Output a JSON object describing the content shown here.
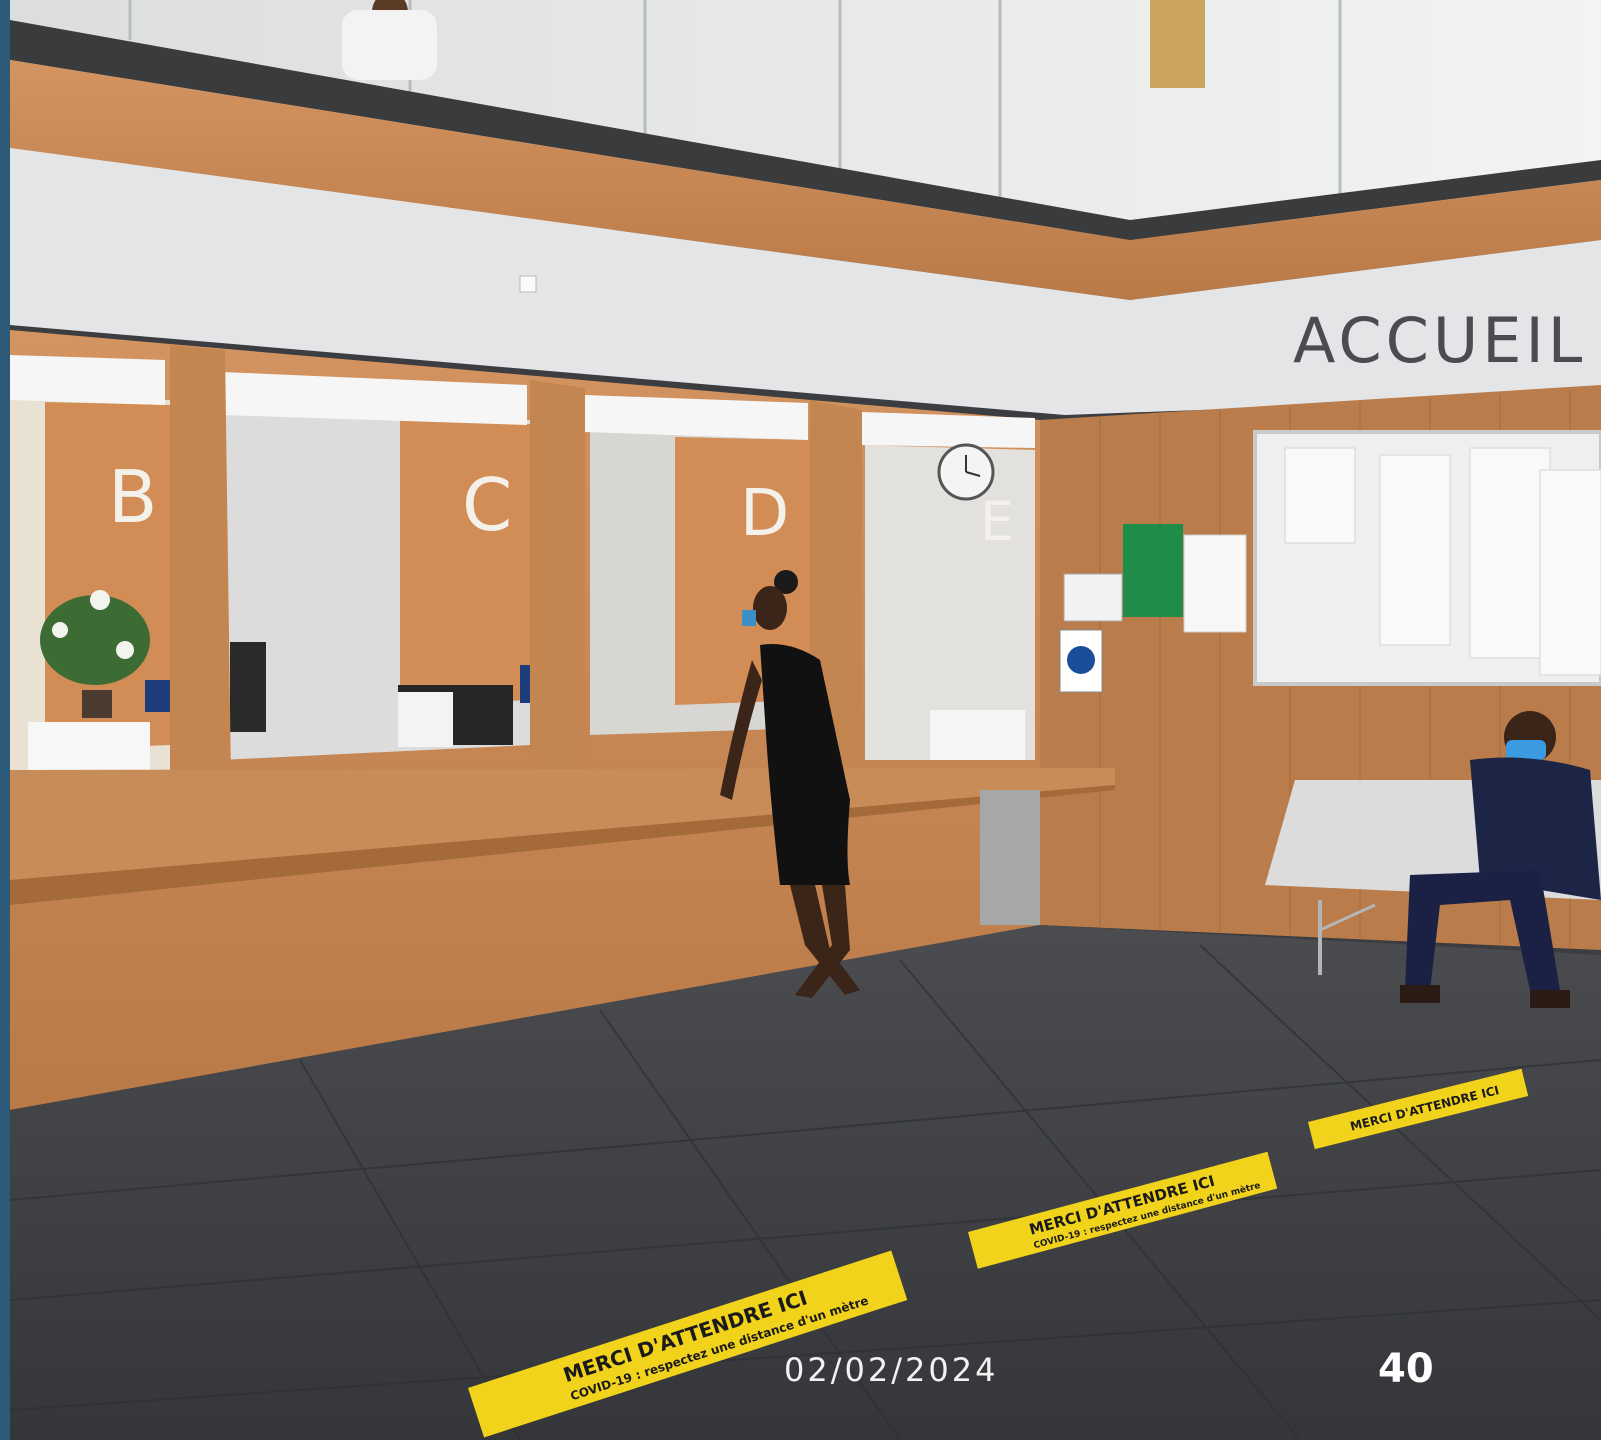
{
  "signage": {
    "hall_sign": "ACCUEIL",
    "counter_letters": [
      "B",
      "C",
      "D",
      "E"
    ],
    "floor_markings": [
      {
        "main": "MERCI D'ATTENDRE ICI",
        "sub": "COVID-19 : respectez une distance d'un mètre"
      },
      {
        "main": "MERCI D'ATTENDRE ICI",
        "sub": "COVID-19 : respectez une distance d'un mètre"
      },
      {
        "main": "MERCI D'ATTENDRE ICI",
        "sub": ""
      }
    ]
  },
  "footer": {
    "date": "02/02/2024",
    "page_number": "40"
  },
  "colors": {
    "wood": "#c98a55",
    "wall_white": "#e6e6e8",
    "floor": "#3f4144",
    "marking_yellow": "#f2d31b",
    "frame_accent": "#2d5a78"
  }
}
